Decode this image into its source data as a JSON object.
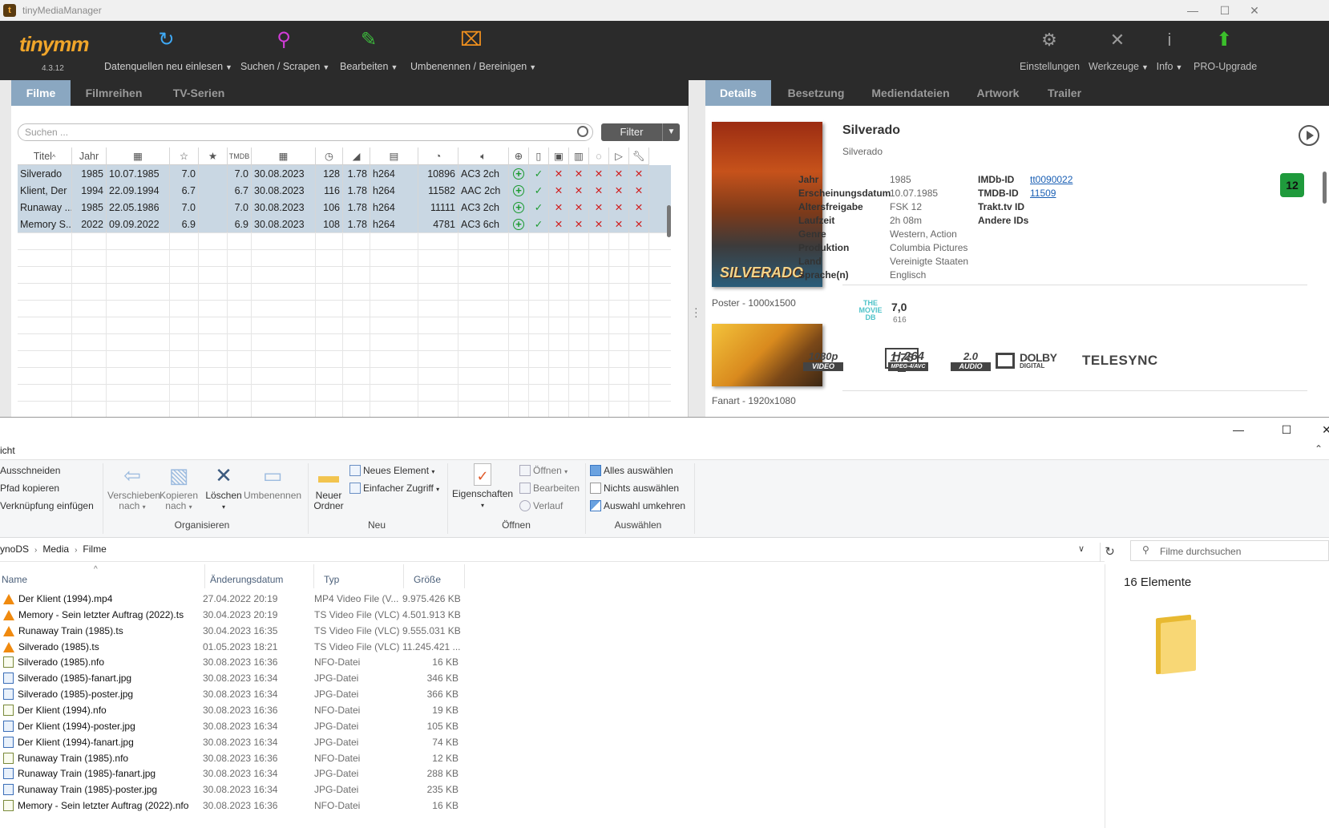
{
  "tmm": {
    "window_title": "tinyMediaManager",
    "logo": "tinymm",
    "version": "4.3.12",
    "toolbar": [
      {
        "label": "Datenquellen neu einlesen",
        "icon": "refresh-icon",
        "color": "#3fa9f5"
      },
      {
        "label": "Suchen / Scrapen",
        "icon": "search-icon",
        "color": "#d23cd8"
      },
      {
        "label": "Bearbeiten",
        "icon": "edit-icon",
        "color": "#3dbb3d"
      },
      {
        "label": "Umbenennen / Bereinigen",
        "icon": "rename-icon",
        "color": "#f0901e"
      }
    ],
    "toolbar_right": [
      {
        "label": "Einstellungen",
        "icon": "gear-icon"
      },
      {
        "label": "Werkzeuge",
        "icon": "tools-icon"
      },
      {
        "label": "Info",
        "icon": "info-icon"
      },
      {
        "label": "PRO-Upgrade",
        "icon": "upgrade-arrow-icon",
        "color": "#3bbf2b"
      }
    ],
    "left_tabs": [
      "Filme",
      "Filmreihen",
      "TV-Serien"
    ],
    "right_tabs": [
      "Details",
      "Besetzung",
      "Mediendateien",
      "Artwork",
      "Trailer"
    ],
    "search_placeholder": "Suchen ...",
    "filter_label": "Filter",
    "columns": [
      "Titel",
      "Jahr",
      "calendar-icon",
      "star-outline-icon",
      "star-filled-icon",
      "TMDB",
      "calendar-added-icon",
      "clock-icon",
      "ratio-icon",
      "file-icon",
      "gauge-icon",
      "audio-icon",
      "plus-icon",
      "nfo-icon",
      "image-icon",
      "film-icon",
      "subtitle-icon",
      "play-icon",
      "wrench-icon"
    ],
    "movies": [
      {
        "title": "Silverado",
        "year": "1985",
        "release": "10.07.1985",
        "rating": "7.0",
        "tmdb": "7.0",
        "added": "30.08.2023",
        "runtime": "128",
        "ratio": "1.78",
        "codec": "h264",
        "bitrate": "10896",
        "audio": "AC3 2ch"
      },
      {
        "title": "Klient, Der",
        "year": "1994",
        "release": "22.09.1994",
        "rating": "6.7",
        "tmdb": "6.7",
        "added": "30.08.2023",
        "runtime": "116",
        "ratio": "1.78",
        "codec": "h264",
        "bitrate": "11582",
        "audio": "AAC 2ch"
      },
      {
        "title": "Runaway ...",
        "year": "1985",
        "release": "22.05.1986",
        "rating": "7.0",
        "tmdb": "7.0",
        "added": "30.08.2023",
        "runtime": "106",
        "ratio": "1.78",
        "codec": "h264",
        "bitrate": "11111",
        "audio": "AC3 2ch"
      },
      {
        "title": "Memory S...",
        "year": "2022",
        "release": "09.09.2022",
        "rating": "6.9",
        "tmdb": "6.9",
        "added": "30.08.2023",
        "runtime": "108",
        "ratio": "1.78",
        "codec": "h264",
        "bitrate": "4781",
        "audio": "AC3 6ch"
      }
    ],
    "detail": {
      "title": "Silverado",
      "original_title": "Silverado",
      "poster_text": "SILVERADO",
      "poster_caption": "Poster - 1000x1500",
      "fanart_caption": "Fanart - 1920x1080",
      "fields": [
        {
          "label": "Jahr",
          "value": "1985"
        },
        {
          "label": "Erscheinungsdatum",
          "value": "10.07.1985"
        },
        {
          "label": "Altersfreigabe",
          "value": "FSK 12"
        },
        {
          "label": "Laufzeit",
          "value": "2h 08m"
        },
        {
          "label": "Genre",
          "value": "Western, Action"
        },
        {
          "label": "Produktion",
          "value": "Columbia Pictures"
        },
        {
          "label": "Land",
          "value": "Vereinigte Staaten"
        },
        {
          "label": "Sprache(n)",
          "value": "Englisch"
        }
      ],
      "ids": [
        {
          "label": "IMDb-ID",
          "value": "tt0090022"
        },
        {
          "label": "TMDB-ID",
          "value": "11509"
        },
        {
          "label": "Trakt.tv ID",
          "value": ""
        },
        {
          "label": "Andere IDs",
          "value": ""
        }
      ],
      "fsk_badge": "12",
      "fsk_color": "#1f9a3c",
      "tmdb_logo": [
        "THE",
        "MOVIE",
        "DB"
      ],
      "rating": "7,0",
      "votes": "616",
      "badges": {
        "resolution": "1080p",
        "resolution_sub": "VIDEO",
        "aspect": "1.78",
        "codec": "H.264",
        "codec_sub": "MPEG-4/AVC",
        "audio_channels": "2.0",
        "audio_sub": "AUDIO",
        "dolby": "DOLBY",
        "dolby_sub": "DIGITAL",
        "source": "TELESYNC"
      }
    }
  },
  "explorer": {
    "ribbon_tab": "icht",
    "clipboard": [
      "Ausschneiden",
      "Pfad kopieren",
      "Verknüpfung einfügen"
    ],
    "organize": {
      "move": [
        "Verschieben",
        "nach"
      ],
      "copy": [
        "Kopieren",
        "nach"
      ],
      "delete": "Löschen",
      "rename": "Umbenennen",
      "group": "Organisieren"
    },
    "new": {
      "new_folder": [
        "Neuer",
        "Ordner"
      ],
      "new_item": "Neues Element",
      "easy_access": "Einfacher Zugriff",
      "group": "Neu"
    },
    "open": {
      "properties": "Eigenschaften",
      "open": "Öffnen",
      "edit": "Bearbeiten",
      "history": "Verlauf",
      "group": "Öffnen"
    },
    "select": {
      "all": "Alles auswählen",
      "none": "Nichts auswählen",
      "invert": "Auswahl umkehren",
      "group": "Auswählen"
    },
    "breadcrumb": [
      "ynoDS",
      "Media",
      "Filme"
    ],
    "search_placeholder": "Filme durchsuchen",
    "columns": [
      "Name",
      "Änderungsdatum",
      "Typ",
      "Größe"
    ],
    "files": [
      {
        "name": "Der Klient (1994).mp4",
        "date": "27.04.2022 20:19",
        "type": "MP4 Video File (V...",
        "size": "9.975.426 KB",
        "icon": "vlc"
      },
      {
        "name": "Memory - Sein letzter Auftrag (2022).ts",
        "date": "30.04.2023 20:19",
        "type": "TS Video File (VLC)",
        "size": "4.501.913 KB",
        "icon": "vlc"
      },
      {
        "name": "Runaway Train (1985).ts",
        "date": "30.04.2023 16:35",
        "type": "TS Video File (VLC)",
        "size": "9.555.031 KB",
        "icon": "vlc"
      },
      {
        "name": "Silverado (1985).ts",
        "date": "01.05.2023 18:21",
        "type": "TS Video File (VLC)",
        "size": "11.245.421 ...",
        "icon": "vlc"
      },
      {
        "name": "Silverado (1985).nfo",
        "date": "30.08.2023 16:36",
        "type": "NFO-Datei",
        "size": "16 KB",
        "icon": "nfo"
      },
      {
        "name": "Silverado (1985)-fanart.jpg",
        "date": "30.08.2023 16:34",
        "type": "JPG-Datei",
        "size": "346 KB",
        "icon": "jpg"
      },
      {
        "name": "Silverado (1985)-poster.jpg",
        "date": "30.08.2023 16:34",
        "type": "JPG-Datei",
        "size": "366 KB",
        "icon": "jpg"
      },
      {
        "name": "Der Klient (1994).nfo",
        "date": "30.08.2023 16:36",
        "type": "NFO-Datei",
        "size": "19 KB",
        "icon": "nfo"
      },
      {
        "name": "Der Klient (1994)-poster.jpg",
        "date": "30.08.2023 16:34",
        "type": "JPG-Datei",
        "size": "105 KB",
        "icon": "jpg"
      },
      {
        "name": "Der Klient (1994)-fanart.jpg",
        "date": "30.08.2023 16:34",
        "type": "JPG-Datei",
        "size": "74 KB",
        "icon": "jpg"
      },
      {
        "name": "Runaway Train (1985).nfo",
        "date": "30.08.2023 16:36",
        "type": "NFO-Datei",
        "size": "12 KB",
        "icon": "nfo"
      },
      {
        "name": "Runaway Train (1985)-fanart.jpg",
        "date": "30.08.2023 16:34",
        "type": "JPG-Datei",
        "size": "288 KB",
        "icon": "jpg"
      },
      {
        "name": "Runaway Train (1985)-poster.jpg",
        "date": "30.08.2023 16:34",
        "type": "JPG-Datei",
        "size": "235 KB",
        "icon": "jpg"
      },
      {
        "name": "Memory - Sein letzter Auftrag (2022).nfo",
        "date": "30.08.2023 16:36",
        "type": "NFO-Datei",
        "size": "16 KB",
        "icon": "nfo"
      }
    ],
    "item_count": "16 Elemente"
  }
}
